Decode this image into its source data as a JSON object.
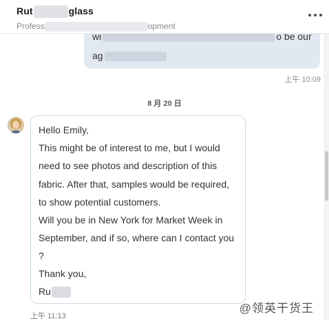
{
  "header": {
    "name_start": "Rut",
    "name_end": "glass",
    "headline_start": "Profess",
    "headline_end": "opment"
  },
  "sent_message": {
    "line1_start": "wi",
    "line1_end": "o be our",
    "line2_start": "ag",
    "time": "上午 10:09"
  },
  "date_divider": "8 月 20 日",
  "received_message": {
    "lines": [
      "Hello Emily,",
      "This might be of interest to me, but I would",
      "need to see photos and description of this",
      "fabric. After that, samples would be required,",
      "to show potential customers.",
      "Will you be in New York for Market Week in",
      "September, and if so, where can I contact you",
      "?",
      "Thank you,",
      "Ru"
    ],
    "time": "上午 11:13"
  },
  "watermark": "@领英干货王",
  "colors": {
    "sent_bubble": "#e1e8f0",
    "received_border": "#cdd9e6"
  }
}
